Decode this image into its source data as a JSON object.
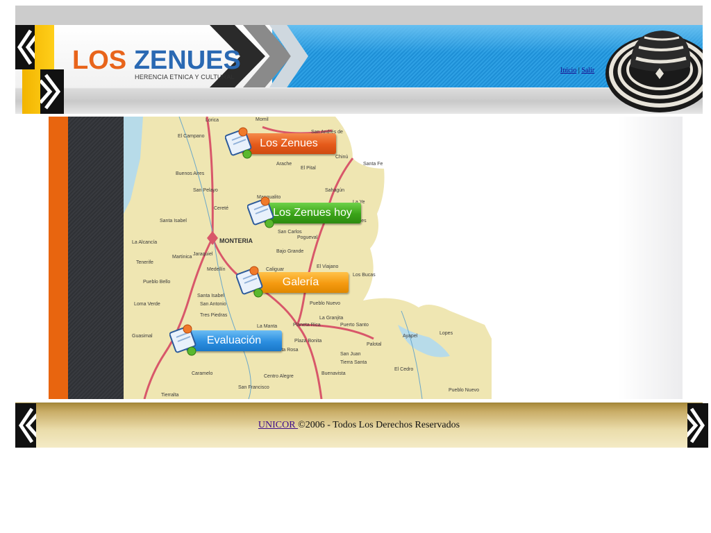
{
  "header": {
    "logo_los": "LOS",
    "logo_zenues": "ZENUES",
    "logo_subtitle": "HERENCIA ETNICA Y CULTURAL",
    "link_inicio": "Inicio",
    "link_separator": "|",
    "link_salir": "Salir"
  },
  "menu": {
    "items": [
      {
        "label": "Los Zenues",
        "color": "#e55a1a"
      },
      {
        "label": "Los Zenues hoy",
        "color": "#3aa318"
      },
      {
        "label": "Galería",
        "color": "#f59a10"
      },
      {
        "label": "Evaluación",
        "color": "#2b8ee0"
      }
    ]
  },
  "map": {
    "city_label": "MONTERIA",
    "places": [
      "Lorica",
      "Momil",
      "San Andrés de",
      "El Campano",
      "Arache",
      "El Pital",
      "Chinú",
      "Santa Fe",
      "Buenos Aires",
      "San Pelayo",
      "Sahagún",
      "Cereté",
      "Mangualito",
      "San Carlos",
      "Los Corrales",
      "La Ye",
      "Santa Isabel",
      "Pogueval",
      "La Alcancía",
      "Martinica",
      "Tenerife",
      "Jaraquiel",
      "Medellín",
      "Bajo Grande",
      "El Viajano",
      "Los Bucas",
      "Pueblo Bello",
      "Caliguar",
      "Loma Verde",
      "Santa Isabel",
      "San Antonio",
      "Pueblo Nuevo",
      "Tres Piedras",
      "La Granjita",
      "Planeta Rica",
      "Puerto Santo",
      "Guasimal",
      "Plaza Bonita",
      "La Manta",
      "Ayapel",
      "Lopes",
      "Tierra Santa",
      "San Juan",
      "Santa Rosa",
      "Buenavista",
      "Centro Alegre",
      "Palotal",
      "El Cedro",
      "Pueblo Nuevo",
      "Caramelo",
      "San Francisco",
      "Tierralta"
    ],
    "colors": {
      "land": "#efe6b2",
      "water": "#b7dbe9",
      "road": "#d8576a"
    }
  },
  "footer": {
    "link": "UNICOR ",
    "text": "©2006 - Todos Los Derechos Reservados"
  },
  "colors": {
    "orange_strip": "#e8650f",
    "dark_strip": "#333539",
    "header_blue": "#2a9ae0"
  }
}
